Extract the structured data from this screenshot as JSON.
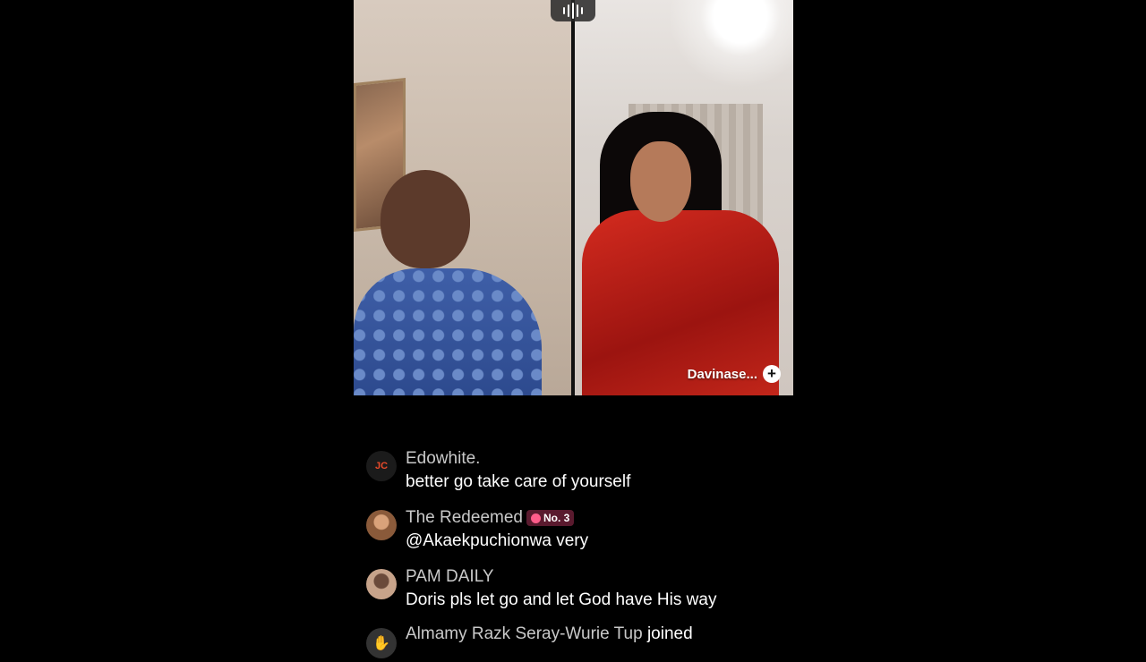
{
  "stream": {
    "guest_name": "Davinase...",
    "audio_icon": "audio-wave-icon",
    "plus_icon": "plus-icon"
  },
  "comments": [
    {
      "username": "Edowhite.",
      "message": "better go take care of yourself",
      "avatar_logo": "JC",
      "avatar_color": "#1b1b1b"
    },
    {
      "username": "The Redeemed",
      "badge": "No. 3",
      "message": "@Akaekpuchionwa very",
      "avatar_color": "#8a5a3a"
    },
    {
      "username": "PAM DAILY",
      "message": "Doris pls let go and let God have His way",
      "avatar_color": "#c7a38a"
    }
  ],
  "joined": {
    "username": "Almamy Razk Seray-Wurie Tup",
    "text": "joined"
  },
  "colors": {
    "background": "#000000",
    "badge_bg": "#5a1a2e",
    "username": "#c9c9c9"
  }
}
